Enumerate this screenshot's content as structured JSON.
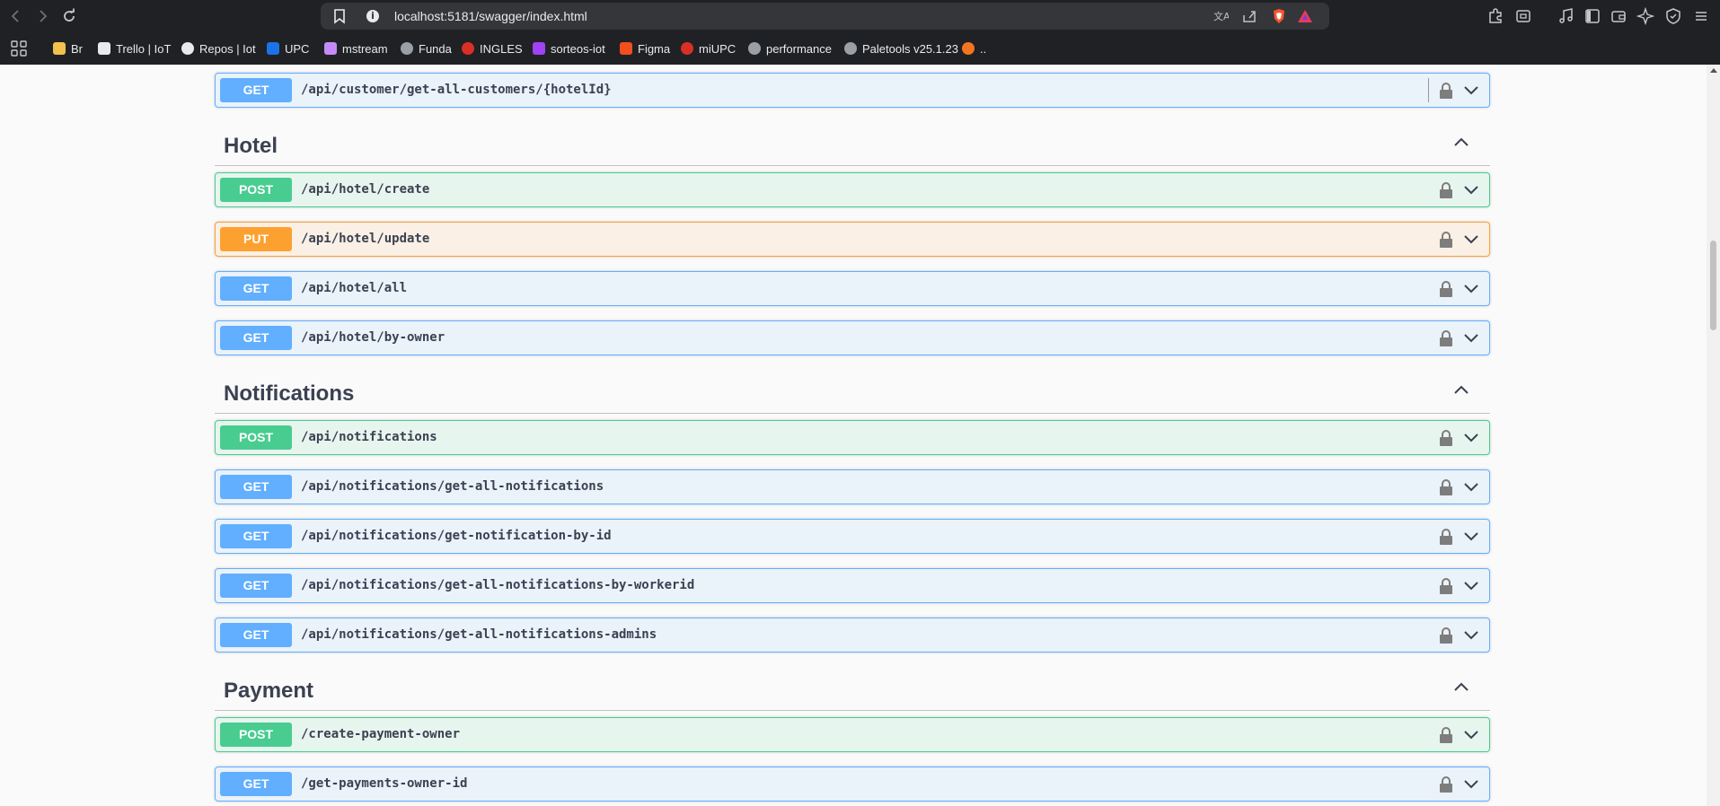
{
  "browser": {
    "url": "localhost:5181/swagger/index.html",
    "bookmarks": [
      {
        "label": "Br",
        "icon": "folder-icon",
        "color": "#f2c14e"
      },
      {
        "label": "Trello | IoT",
        "icon": "trello-icon",
        "color": "#e8eaed"
      },
      {
        "label": "Repos | Iot",
        "icon": "github-icon",
        "color": "#e8eaed"
      },
      {
        "label": "UPC",
        "icon": "upc-icon",
        "color": "#1a73e8"
      },
      {
        "label": "mstream",
        "icon": "mstream-icon",
        "color": "#c58af9"
      },
      {
        "label": "Funda",
        "icon": "globe-icon",
        "color": "#9aa0a6"
      },
      {
        "label": "INGLES",
        "icon": "upc-red-icon",
        "color": "#d93025"
      },
      {
        "label": "sorteos-iot",
        "icon": "sorteos-icon",
        "color": "#a142f4"
      },
      {
        "label": "Figma",
        "icon": "figma-icon",
        "color": "#f24e1e"
      },
      {
        "label": "miUPC",
        "icon": "upc-red-icon",
        "color": "#d93025"
      },
      {
        "label": "performance",
        "icon": "globe-icon",
        "color": "#9aa0a6"
      },
      {
        "label": "Paletools v25.1.23",
        "icon": "globe-icon",
        "color": "#9aa0a6"
      },
      {
        "label": "..",
        "icon": "crunchyroll-icon",
        "color": "#f47521"
      }
    ]
  },
  "sections": [
    {
      "name": "",
      "endpoints": [
        {
          "method": "GET",
          "path": "/api/customer/get-all-customers/{hotelId}"
        }
      ]
    },
    {
      "name": "Hotel",
      "endpoints": [
        {
          "method": "POST",
          "path": "/api/hotel/create"
        },
        {
          "method": "PUT",
          "path": "/api/hotel/update"
        },
        {
          "method": "GET",
          "path": "/api/hotel/all"
        },
        {
          "method": "GET",
          "path": "/api/hotel/by-owner"
        }
      ]
    },
    {
      "name": "Notifications",
      "endpoints": [
        {
          "method": "POST",
          "path": "/api/notifications"
        },
        {
          "method": "GET",
          "path": "/api/notifications/get-all-notifications"
        },
        {
          "method": "GET",
          "path": "/api/notifications/get-notification-by-id"
        },
        {
          "method": "GET",
          "path": "/api/notifications/get-all-notifications-by-workerid"
        },
        {
          "method": "GET",
          "path": "/api/notifications/get-all-notifications-admins"
        }
      ]
    },
    {
      "name": "Payment",
      "endpoints": [
        {
          "method": "POST",
          "path": "/create-payment-owner"
        },
        {
          "method": "GET",
          "path": "/get-payments-owner-id"
        }
      ]
    }
  ],
  "colors": {
    "get": "#61affe",
    "post": "#49cc90",
    "put": "#fca130"
  }
}
